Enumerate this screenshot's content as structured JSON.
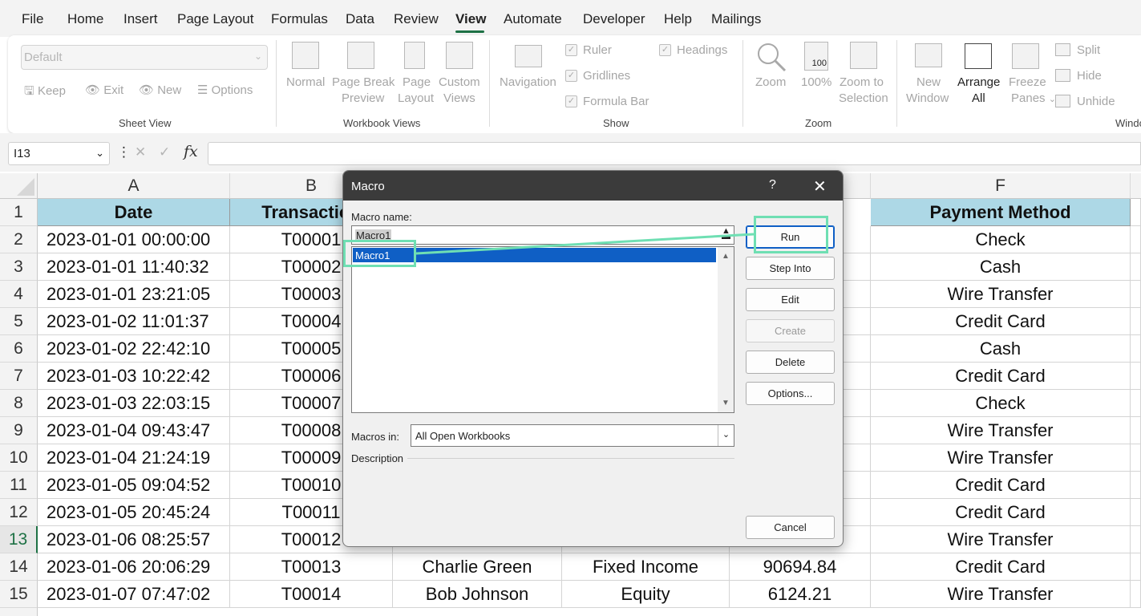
{
  "menu": {
    "tabs": [
      "File",
      "Home",
      "Insert",
      "Page Layout",
      "Formulas",
      "Data",
      "Review",
      "View",
      "Automate",
      "Developer",
      "Help",
      "Mailings"
    ],
    "active_tab": "View"
  },
  "ribbon": {
    "sheet_view": {
      "combo_value": "Default",
      "keep": "Keep",
      "exit": "Exit",
      "new": "New",
      "options": "Options",
      "group_label": "Sheet View"
    },
    "workbook_views": {
      "normal": "Normal",
      "page_break_1": "Page Break",
      "page_break_2": "Preview",
      "page_layout_1": "Page",
      "page_layout_2": "Layout",
      "custom_1": "Custom",
      "custom_2": "Views",
      "group_label": "Workbook Views"
    },
    "show": {
      "navigation": "Navigation",
      "ruler": "Ruler",
      "gridlines": "Gridlines",
      "formula_bar": "Formula Bar",
      "headings": "Headings",
      "group_label": "Show"
    },
    "zoom": {
      "zoom": "Zoom",
      "hundred": "100%",
      "hundred_icon": "100",
      "zoom_sel_1": "Zoom to",
      "zoom_sel_2": "Selection",
      "group_label": "Zoom"
    },
    "window": {
      "new_1": "New",
      "new_2": "Window",
      "arrange_1": "Arrange",
      "arrange_2": "All",
      "freeze_1": "Freeze",
      "freeze_2": "Panes",
      "split": "Split",
      "hide": "Hide",
      "unhide": "Unhide",
      "group_label": "Windo"
    }
  },
  "formula_bar": {
    "name_box": "I13",
    "fx": "fx",
    "content": ""
  },
  "sheet": {
    "columns": [
      "A",
      "B",
      "F"
    ],
    "header_row": [
      "Date",
      "Transaction",
      "Payment Method"
    ],
    "row_numbers": [
      "1",
      "2",
      "3",
      "4",
      "5",
      "6",
      "7",
      "8",
      "9",
      "10",
      "11",
      "12",
      "13",
      "14",
      "15"
    ],
    "selected_row": "13",
    "rows": [
      {
        "date": "2023-01-01 00:00:00",
        "id": "T00001",
        "pay": "Check"
      },
      {
        "date": "2023-01-01 11:40:32",
        "id": "T00002",
        "pay": "Cash"
      },
      {
        "date": "2023-01-01 23:21:05",
        "id": "T00003",
        "pay": "Wire Transfer"
      },
      {
        "date": "2023-01-02 11:01:37",
        "id": "T00004",
        "pay": "Credit Card"
      },
      {
        "date": "2023-01-02 22:42:10",
        "id": "T00005",
        "pay": "Cash"
      },
      {
        "date": "2023-01-03 10:22:42",
        "id": "T00006",
        "pay": "Credit Card"
      },
      {
        "date": "2023-01-03 22:03:15",
        "id": "T00007",
        "pay": "Check"
      },
      {
        "date": "2023-01-04 09:43:47",
        "id": "T00008",
        "pay": "Wire Transfer"
      },
      {
        "date": "2023-01-04 21:24:19",
        "id": "T00009",
        "pay": "Wire Transfer"
      },
      {
        "date": "2023-01-05 09:04:52",
        "id": "T00010",
        "pay": "Credit Card"
      },
      {
        "date": "2023-01-05 20:45:24",
        "id": "T00011",
        "pay": "Credit Card"
      },
      {
        "date": "2023-01-06 08:25:57",
        "id": "T00012",
        "pay": "Wire Transfer"
      },
      {
        "date": "2023-01-06 20:06:29",
        "id": "T00013",
        "name": "Charlie Green",
        "type": "Fixed Income",
        "amount": "90694.84",
        "pay": "Credit Card"
      },
      {
        "date": "2023-01-07 07:47:02",
        "id": "T00014",
        "name": "Bob Johnson",
        "type": "Equity",
        "amount": "6124.21",
        "pay": "Wire Transfer"
      }
    ]
  },
  "dialog": {
    "title": "Macro",
    "help": "?",
    "close": "✕",
    "macro_name_label": "Macro name:",
    "macro_name_value": "Macro1",
    "list_items": [
      "Macro1"
    ],
    "buttons": {
      "run": "Run",
      "step_into": "Step Into",
      "edit": "Edit",
      "create": "Create",
      "delete": "Delete",
      "options": "Options...",
      "cancel": "Cancel"
    },
    "macros_in_label": "Macros in:",
    "macros_in_value": "All Open Workbooks",
    "description_label": "Description"
  },
  "colors": {
    "accent_green": "#1e7145",
    "header_fill": "#add8e6",
    "highlight": "#6fdfb3",
    "list_selection": "#0f5fc5",
    "dialog_titlebar": "#3b3b3b"
  }
}
